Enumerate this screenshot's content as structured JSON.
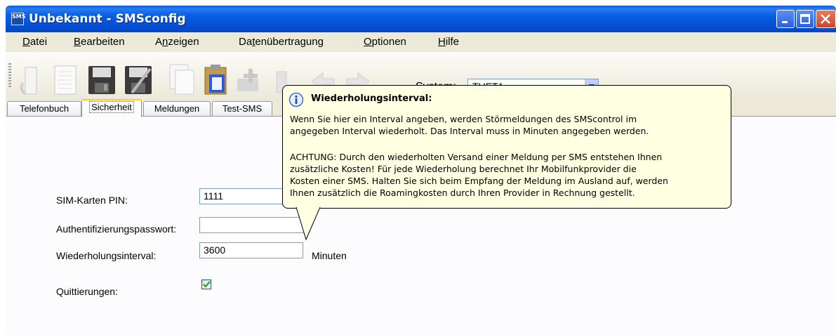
{
  "window": {
    "title": "Unbekannt - SMSconfig",
    "app_icon_text": "SMS"
  },
  "menu": {
    "items": [
      {
        "label": "Datei",
        "hotkey": "D",
        "rest": "atei"
      },
      {
        "label": "Bearbeiten",
        "hotkey": "B",
        "rest": "earbeiten"
      },
      {
        "label": "Anzeigen",
        "pre": "A",
        "hotkey": "n",
        "rest": "zeigen"
      },
      {
        "label": "Datenübertragung",
        "pre": "Da",
        "hotkey": "t",
        "rest": "enübertragung"
      },
      {
        "label": "Optionen",
        "hotkey": "O",
        "rest": "ptionen"
      },
      {
        "label": "Hilfe",
        "hotkey": "H",
        "rest": "ilfe"
      }
    ]
  },
  "toolbar": {
    "system_label": "System:",
    "system_value": "THETA"
  },
  "tabs": {
    "items": [
      "Telefonbuch",
      "Sicherheit",
      "Meldungen",
      "Test-SMS"
    ],
    "active": "Sicherheit"
  },
  "form": {
    "pin_label": "SIM-Karten PIN:",
    "pin_value": "1111",
    "auth_label": "Authentifizierungspasswort:",
    "auth_value": "",
    "interval_label": "Wiederholungsinterval:",
    "interval_value": "3600",
    "interval_unit": "Minuten",
    "ack_label": "Quittierungen:",
    "ack_checked": true
  },
  "balloon": {
    "title": "Wiederholungsinterval:",
    "paragraph1": "Wenn Sie hier ein Interval angeben, werden Störmeldungen des SMScontrol im\nangegeben Interval wiederholt. Das Interval muss in Minuten angegeben werden.",
    "paragraph2": "ACHTUNG: Durch den wiederholten Versand einer Meldung per SMS entstehen Ihnen\nzusätzliche Kosten! Für jede Wiederholung berechnet Ihr Mobilfunkprovider die\nKosten einer SMS. Halten Sie sich beim Empfang der Meldung im Ausland auf, werden\nIhnen zusätzlich die Roamingkosten durch Ihren Provider in Rechnung gestellt."
  },
  "icons": [
    "app-icon",
    "open-icon",
    "new-document-icon",
    "save-icon",
    "save-as-icon",
    "copy-icon",
    "paste-icon",
    "add-icon",
    "delete-icon",
    "back-icon",
    "forward-icon",
    "info-icon",
    "minimize-icon",
    "maximize-icon",
    "close-icon",
    "checkmark-icon",
    "dropdown-arrow-icon"
  ],
  "colors": {
    "titlebar": "#0a5bdb",
    "tooltip_bg": "#ffffe1",
    "tab_highlight": "#ffc83c",
    "checkmark": "#21a121"
  }
}
